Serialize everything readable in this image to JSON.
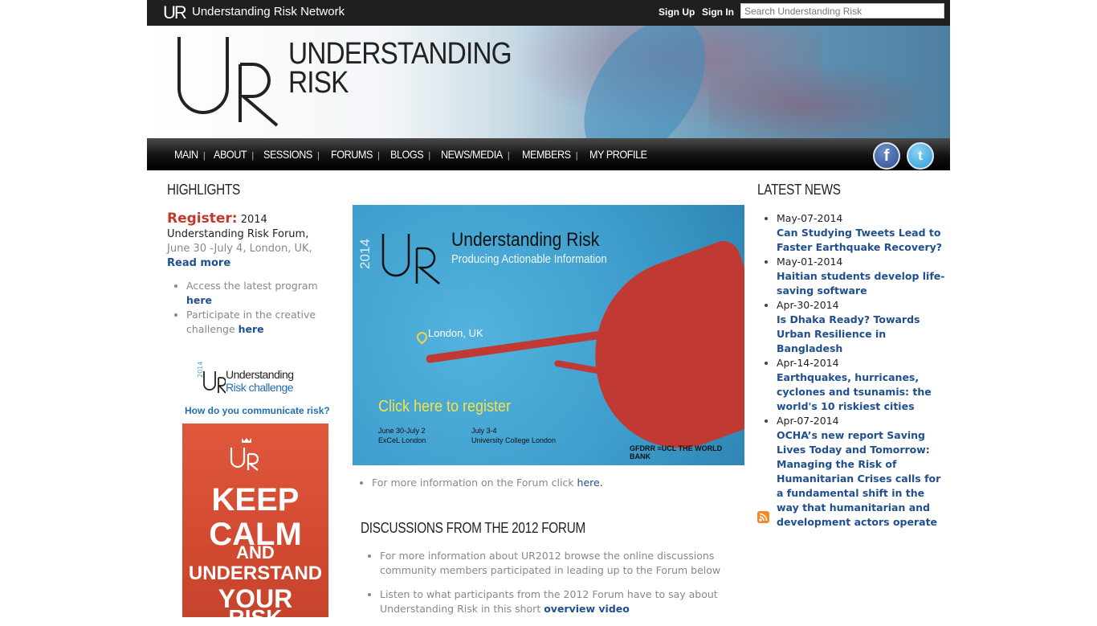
{
  "topbar": {
    "logo_text": "UR",
    "site_name": "Understanding Risk Network",
    "sign_up": "Sign Up",
    "sign_in": "Sign In",
    "search_placeholder": "Search Understanding Risk"
  },
  "banner": {
    "title_line1": "UNDERSTANDING",
    "title_line2": "RISK"
  },
  "nav": {
    "items": [
      "MAIN",
      "ABOUT",
      "SESSIONS",
      "FORUMS",
      "BLOGS",
      "NEWS/MEDIA",
      "MEMBERS",
      "MY PROFILE"
    ],
    "facebook_letter": "f",
    "twitter_letter": "t"
  },
  "highlights": {
    "heading": "HIGHLIGHTS",
    "register_label": "Register:",
    "register_text": "2014 Understanding Risk Forum,",
    "register_dates": "June 30 -July 4, London, UK,",
    "read_more": "Read more",
    "bullets": [
      {
        "text": "Access the latest program",
        "link": "here"
      },
      {
        "text": "Participate in the creative challenge",
        "link": "here"
      }
    ],
    "challenge_year": "2014",
    "challenge_line1": "Understanding",
    "challenge_line2": "Risk challenge",
    "challenge_question": "How do you communicate risk?",
    "poster_lines": [
      "KEEP",
      "CALM",
      "AND",
      "UNDERSTAND",
      "YOUR",
      "RISK"
    ]
  },
  "promo": {
    "year": "2014",
    "title": "Understanding Risk",
    "subtitle": "Producing Actionable Information",
    "location": "London, UK",
    "cta": "Click here to register",
    "date1_line1": "June 30-July 2",
    "date1_line2": "ExCeL London",
    "date2_line1": "July 3-4",
    "date2_line2": "University College London",
    "logos": "GFDRR  ≡UCL  THE WORLD BANK"
  },
  "center": {
    "more_info_text": "For more information on the Forum click",
    "more_info_link": "here.",
    "discussions_heading": "DISCUSSIONS FROM THE 2012 FORUM",
    "discussions": [
      {
        "text": "For more information about UR2012 browse the online discussions community members participated in leading up to the Forum below",
        "link": ""
      },
      {
        "text": "Listen to what participants from the 2012 Forum have to say about Understanding Risk in this short",
        "link": "overview video"
      }
    ]
  },
  "latest_news": {
    "heading": "LATEST NEWS",
    "items": [
      {
        "date": "May-07-2014",
        "title": "Can Studying Tweets Lead to Faster Earthquake Recovery?"
      },
      {
        "date": "May-01-2014",
        "title": "Haitian students develop life-saving software"
      },
      {
        "date": "Apr-30-2014",
        "title": "Is Dhaka Ready? Towards Urban Resilience in Bangladesh"
      },
      {
        "date": "Apr-14-2014",
        "title": "Earthquakes, hurricanes, cyclones and tsunamis: the world's 10 riskiest cities"
      },
      {
        "date": "Apr-07-2014",
        "title": "OCHA’s new report Saving Lives Today and Tomorrow: Managing the Risk of Humanitarian Crises calls for a fundamental shift in the way that humanitarian and development actors operate"
      }
    ]
  },
  "colors": {
    "topbar_bg": "#1f1f1f",
    "link_blue": "#1f4f8e",
    "register_red": "#c0392b",
    "rss_orange": "#f08a24"
  }
}
